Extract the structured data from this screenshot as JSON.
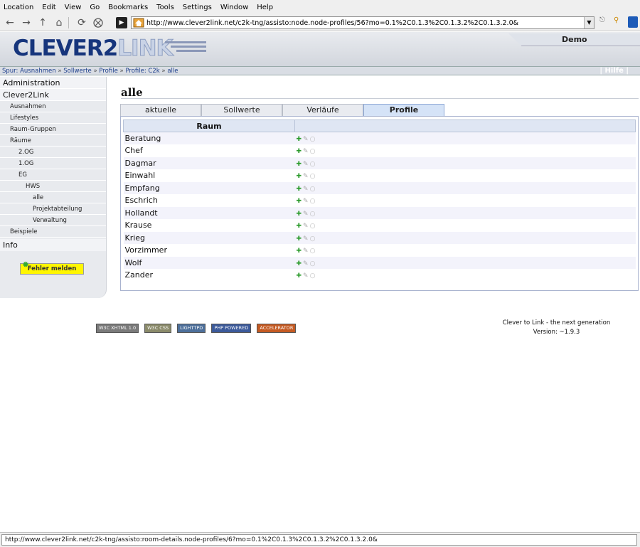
{
  "browser": {
    "menu": [
      "Location",
      "Edit",
      "View",
      "Go",
      "Bookmarks",
      "Tools",
      "Settings",
      "Window",
      "Help"
    ],
    "url": "http://www.clever2link.net/c2k-tng/assisto:node.node-profiles/56?mo=0.1%2C0.1.3%2C0.1.3.2%2C0.1.3.2.0&",
    "status": "http://www.clever2link.net/c2k-tng/assisto:room-details.node-profiles/6?mo=0.1%2C0.1.3%2C0.1.3.2%2C0.1.3.2.0&"
  },
  "header": {
    "logo_part1": "CLEVER2",
    "logo_part2": "LINK",
    "demo": "Demo"
  },
  "breadcrumb": {
    "prefix": "Spur:",
    "items": [
      "Ausnahmen",
      "Sollwerte",
      "Profile",
      "Profile: C2k",
      "alle"
    ],
    "separator": "»",
    "help": "| Hilfe |"
  },
  "sidebar": {
    "top_items": [
      "Administration",
      "Clever2Link"
    ],
    "items": [
      {
        "label": "Ausnahmen",
        "level": 1
      },
      {
        "label": "Lifestyles",
        "level": 1
      },
      {
        "label": "Raum-Gruppen",
        "level": 1
      },
      {
        "label": "Räume",
        "level": 1
      },
      {
        "label": "2.OG",
        "level": 2
      },
      {
        "label": "1.OG",
        "level": 2
      },
      {
        "label": "EG",
        "level": 2
      },
      {
        "label": "HWS",
        "level": 3
      },
      {
        "label": "alle",
        "level": 4
      },
      {
        "label": "Projektabteilung",
        "level": 4
      },
      {
        "label": "Verwaltung",
        "level": 4
      },
      {
        "label": "Beispiele",
        "level": 1
      }
    ],
    "info": "Info",
    "report_button": "Fehler melden"
  },
  "main": {
    "title": "alle",
    "tabs": [
      {
        "label": "aktuelle",
        "active": false
      },
      {
        "label": "Sollwerte",
        "active": false
      },
      {
        "label": "Verläufe",
        "active": false
      },
      {
        "label": "Profile",
        "active": true
      }
    ],
    "table": {
      "header": "Raum",
      "rows": [
        "Beratung",
        "Chef",
        "Dagmar",
        "Einwahl",
        "Empfang",
        "Eschrich",
        "Hollandt",
        "Krause",
        "Krieg",
        "Vorzimmer",
        "Wolf",
        "Zander"
      ]
    }
  },
  "footer": {
    "badges": [
      "W3C XHTML 1.0",
      "W3C CSS",
      "LIGHTTPD",
      "PHP POWERED",
      "ACCELERATOR"
    ],
    "line1": "Clever to Link - the next generation",
    "line2": "Version: ~1.9.3"
  },
  "colors": {
    "accent": "#16357c",
    "tab_active": "#d5e3f7",
    "report_button": "#fff600"
  }
}
